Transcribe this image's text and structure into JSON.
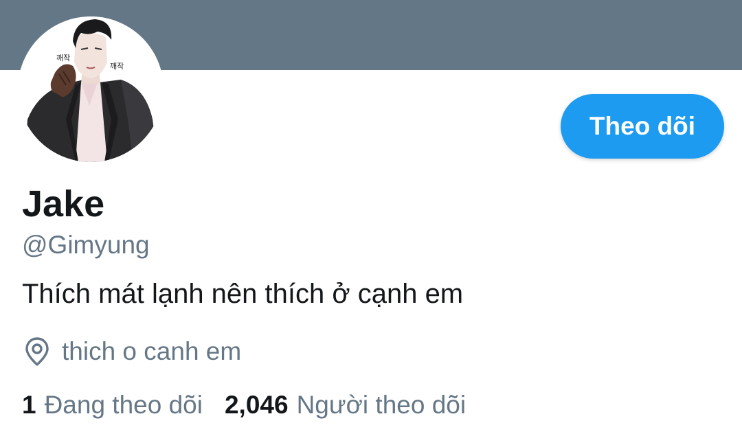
{
  "profile": {
    "display_name": "Jake",
    "handle": "@Gimyung",
    "bio": "Thích mát lạnh nên thích ở cạnh em",
    "location": "thich o canh em",
    "avatar_sfx_left": "깨작",
    "avatar_sfx_right": "깨작"
  },
  "actions": {
    "follow_label": "Theo dõi"
  },
  "stats": {
    "following_count": "1",
    "following_label": "Đang theo dõi",
    "followers_count": "2,046",
    "followers_label": "Người theo dõi"
  },
  "colors": {
    "banner": "#647787",
    "accent": "#1d9bf0",
    "text_primary": "#14171a",
    "text_secondary": "#657786"
  },
  "icons": {
    "location": "location-pin-icon"
  }
}
